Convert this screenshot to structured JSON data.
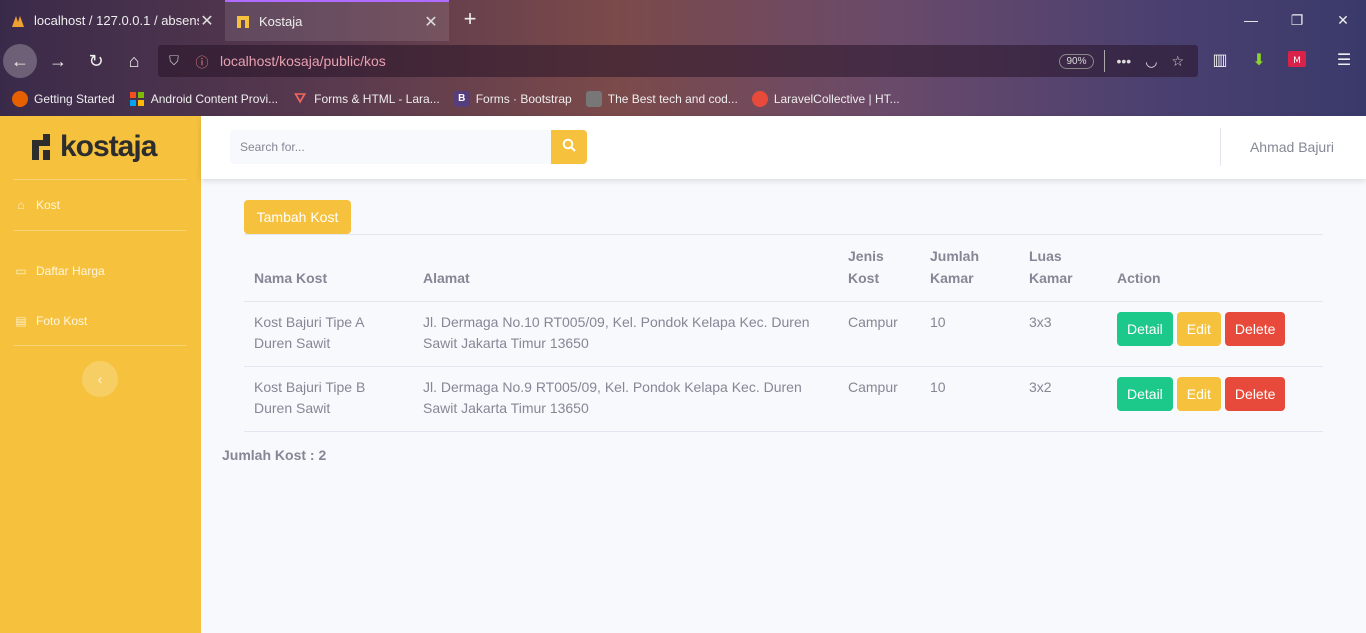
{
  "browser": {
    "tabs": [
      {
        "title": "localhost / 127.0.0.1 / absensi",
        "active": false
      },
      {
        "title": "Kostaja",
        "active": true
      }
    ],
    "url": "localhost/kosaja/public/kos",
    "zoom": "90%",
    "bookmarks": [
      {
        "label": "Getting Started",
        "icon": "firefox-icon",
        "color": "#e66000"
      },
      {
        "label": "Android Content Provi...",
        "icon": "microsoft-icon",
        "color": "#7fba00"
      },
      {
        "label": "Forms & HTML - Lara...",
        "icon": "laravel-icon",
        "color": "#f4645f"
      },
      {
        "label": "Forms · Bootstrap",
        "icon": "bootstrap-icon",
        "color": "#563d7c"
      },
      {
        "label": "The Best tech and cod...",
        "icon": "image-icon",
        "color": "#888888"
      },
      {
        "label": "LaravelCollective | HT...",
        "icon": "laravelcollective-icon",
        "color": "#e74a3b"
      }
    ]
  },
  "sidebar": {
    "brand": "kostaja",
    "items": [
      {
        "label": "Kost",
        "icon": "home-icon"
      },
      {
        "label": "Daftar Harga",
        "icon": "money-icon"
      },
      {
        "label": "Foto Kost",
        "icon": "images-icon"
      }
    ]
  },
  "topbar": {
    "search_placeholder": "Search for...",
    "user": "Ahmad Bajuri"
  },
  "main": {
    "add_label": "Tambah Kost",
    "columns": [
      "Nama Kost",
      "Alamat",
      "Jenis Kost",
      "Jumlah Kamar",
      "Luas Kamar",
      "Action"
    ],
    "rows": [
      {
        "nama": "Kost Bajuri Tipe A Duren Sawit",
        "alamat": "Jl. Dermaga No.10 RT005/09, Kel. Pondok Kelapa Kec. Duren Sawit Jakarta Timur 13650",
        "jenis": "Campur",
        "jumlah": "10",
        "luas": "3x3"
      },
      {
        "nama": "Kost Bajuri Tipe B Duren Sawit",
        "alamat": "Jl. Dermaga No.9 RT005/09, Kel. Pondok Kelapa Kec. Duren Sawit Jakarta Timur 13650",
        "jenis": "Campur",
        "jumlah": "10",
        "luas": "3x2"
      }
    ],
    "actions": {
      "detail": "Detail",
      "edit": "Edit",
      "delete": "Delete"
    },
    "total": "Jumlah Kost : 2"
  },
  "colors": {
    "primary": "#f6c23e",
    "success": "#1cc88a",
    "danger": "#e74a3b",
    "text": "#858796"
  }
}
